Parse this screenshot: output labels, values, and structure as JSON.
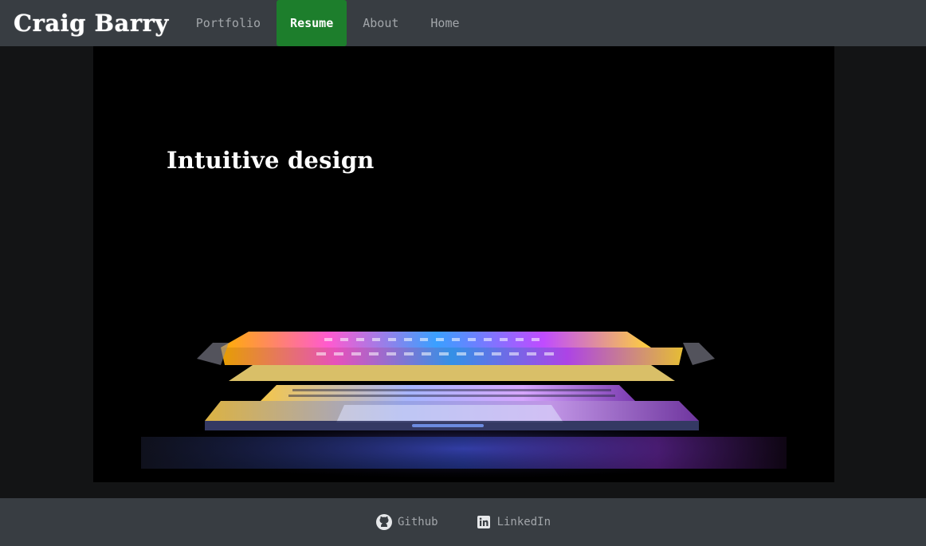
{
  "brand": "Craig Barry",
  "nav": {
    "items": [
      {
        "label": "Portfolio",
        "active": false
      },
      {
        "label": "Resume",
        "active": true
      },
      {
        "label": "About",
        "active": false
      },
      {
        "label": "Home",
        "active": false
      }
    ]
  },
  "hero": {
    "heading": "Intuitive design",
    "image": "glowing-laptop-photo"
  },
  "footer": {
    "links": [
      {
        "label": "Github",
        "icon": "github-icon"
      },
      {
        "label": "LinkedIn",
        "icon": "linkedin-icon"
      }
    ]
  },
  "colors": {
    "navbar_bg": "#383d42",
    "active_tab": "#1d7e2c",
    "page_bg": "#131415",
    "nav_text": "#a2a6aa"
  }
}
